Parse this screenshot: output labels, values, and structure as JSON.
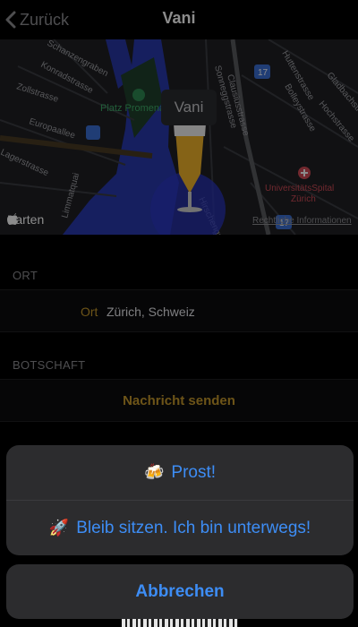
{
  "nav": {
    "back_label": "Zurück",
    "title": "Vani"
  },
  "map": {
    "pin_label": "Vani",
    "credit": "Karten",
    "legal": "Rechtliche Informationen",
    "streets": [
      "Schanzengraben",
      "Konradstrasse",
      "Zollstrasse",
      "Europaallee",
      "Lagerstrasse",
      "Sonneggstrasse",
      "Clausiusstrasse",
      "Huttenstrasse",
      "Bolleystrasse",
      "Gladbachstrasse",
      "Hochstrasse",
      "Hirschengraben",
      "Limmatquai"
    ],
    "places": [
      "Platz Promenade",
      "UniversitätsSpital Zürich"
    ],
    "route_badge": "17",
    "colors": {
      "water": "#2a3cbd",
      "accent": "#c79a2d",
      "hospital": "#cf4b57"
    }
  },
  "location": {
    "header": "ORT",
    "key": "Ort",
    "value": "Zürich, Schweiz"
  },
  "message": {
    "header": "BOTSCHAFT",
    "send_label": "Nachricht senden"
  },
  "action_sheet": {
    "options": [
      {
        "emoji": "🍻",
        "label": "Prost!"
      },
      {
        "emoji": "🚀",
        "label": "Bleib sitzen. Ich bin unterwegs!"
      }
    ],
    "cancel_label": "Abbrechen"
  },
  "colors": {
    "action_blue": "#3d8df5",
    "accent_gold": "#c79a2d",
    "sheet_bg": "#2c2c2e"
  }
}
